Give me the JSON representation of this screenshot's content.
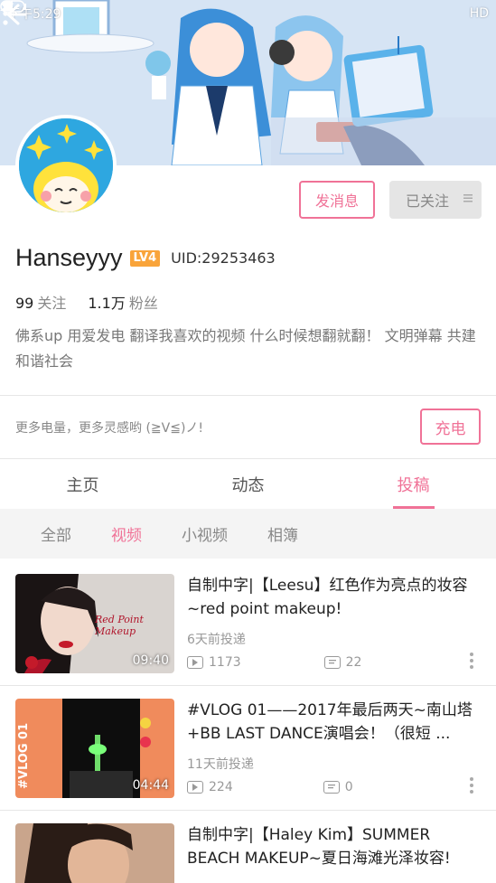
{
  "status_bar": {
    "time": "下午5:29",
    "network": "HD"
  },
  "profile": {
    "username": "Hanseyyy",
    "level": "LV4",
    "uid": "UID:29253463",
    "following_count": "99",
    "following_label": "关注",
    "followers_count": "1.1万",
    "followers_label": "粉丝",
    "bio": "佛系up  用爱发电  翻译我喜欢的视频 什么时候想翻就翻！ 文明弹幕 共建和谐社会"
  },
  "actions": {
    "message_label": "发消息",
    "followed_label": "已关注",
    "charge_text": "更多电量，更多灵感哟 (≧V≦)ノ!",
    "charge_label": "充电"
  },
  "tabs": [
    {
      "label": "主页",
      "active": false
    },
    {
      "label": "动态",
      "active": false
    },
    {
      "label": "投稿",
      "active": true
    }
  ],
  "subtabs": [
    {
      "label": "全部",
      "active": false
    },
    {
      "label": "视频",
      "active": true
    },
    {
      "label": "小视频",
      "active": false
    },
    {
      "label": "相簿",
      "active": false
    }
  ],
  "videos": [
    {
      "title": "自制中字|【Leesu】红色作为亮点的妆容~red point makeup!",
      "time": "6天前投递",
      "plays": "1173",
      "danmaku": "22",
      "duration": "09:40",
      "thumb_text": "Red Point Makeup"
    },
    {
      "title": "#VLOG 01——2017年最后两天~南山塔+BB LAST DANCE演唱会！（很短 ...",
      "time": "11天前投递",
      "plays": "224",
      "danmaku": "0",
      "duration": "04:44",
      "thumb_text": "#VLOG 01"
    },
    {
      "title": "自制中字|【Haley Kim】SUMMER BEACH MAKEUP~夏日海滩光泽妆容!",
      "time": "",
      "plays": "",
      "danmaku": "",
      "duration": ""
    }
  ],
  "colors": {
    "accent": "#f07297",
    "level": "#f9a43a",
    "avatar_bg": "#2ea7e0"
  }
}
